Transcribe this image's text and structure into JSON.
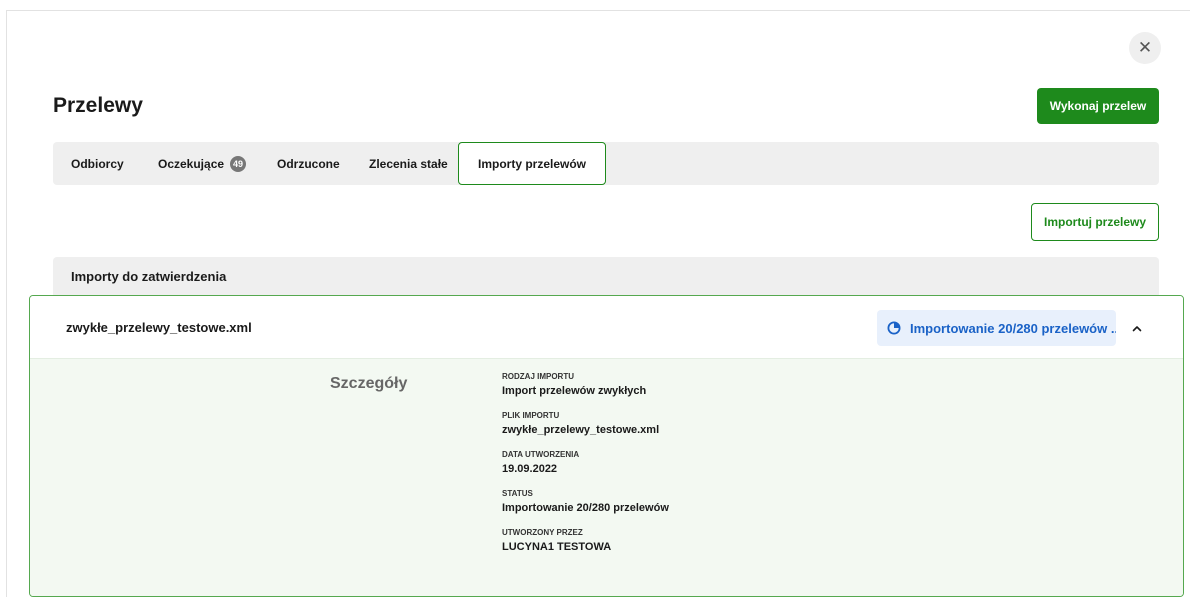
{
  "header": {
    "title": "Przelewy",
    "primary_button": "Wykonaj przelew",
    "close_icon": "close-icon"
  },
  "tabs": [
    {
      "label": "Odbiorcy",
      "badge": null,
      "active": false
    },
    {
      "label": "Oczekujące",
      "badge": "49",
      "active": false
    },
    {
      "label": "Odrzucone",
      "badge": null,
      "active": false
    },
    {
      "label": "Zlecenia stałe",
      "badge": null,
      "active": false
    },
    {
      "label": "Importy przelewów",
      "badge": null,
      "active": true
    }
  ],
  "actions": {
    "import_button": "Importuj przelewy"
  },
  "section": {
    "title": "Importy do zatwierdzenia"
  },
  "import_item": {
    "file_name": "zwykłe_przelewy_testowe.xml",
    "status_badge": "Importowanie 20/280 przelewów ...",
    "status_icon": "pie-chart-icon",
    "expand_icon": "chevron-up-icon",
    "details_heading": "Szczegóły",
    "details": [
      {
        "label": "RODZAJ IMPORTU",
        "value": "Import przelewów zwykłych"
      },
      {
        "label": "PLIK IMPORTU",
        "value": "zwykłe_przelewy_testowe.xml"
      },
      {
        "label": "DATA UTWORZENIA",
        "value": "19.09.2022"
      },
      {
        "label": "STATUS",
        "value": "Importowanie 20/280 przelewów"
      },
      {
        "label": "UTWORZONY PRZEZ",
        "value": "LUCYNA1 TESTOWA"
      }
    ]
  },
  "colors": {
    "accent_green": "#1e8a1c",
    "status_blue": "#1a62c7",
    "status_bg": "#e8f0fc",
    "card_body_bg": "#f3f9f2"
  }
}
